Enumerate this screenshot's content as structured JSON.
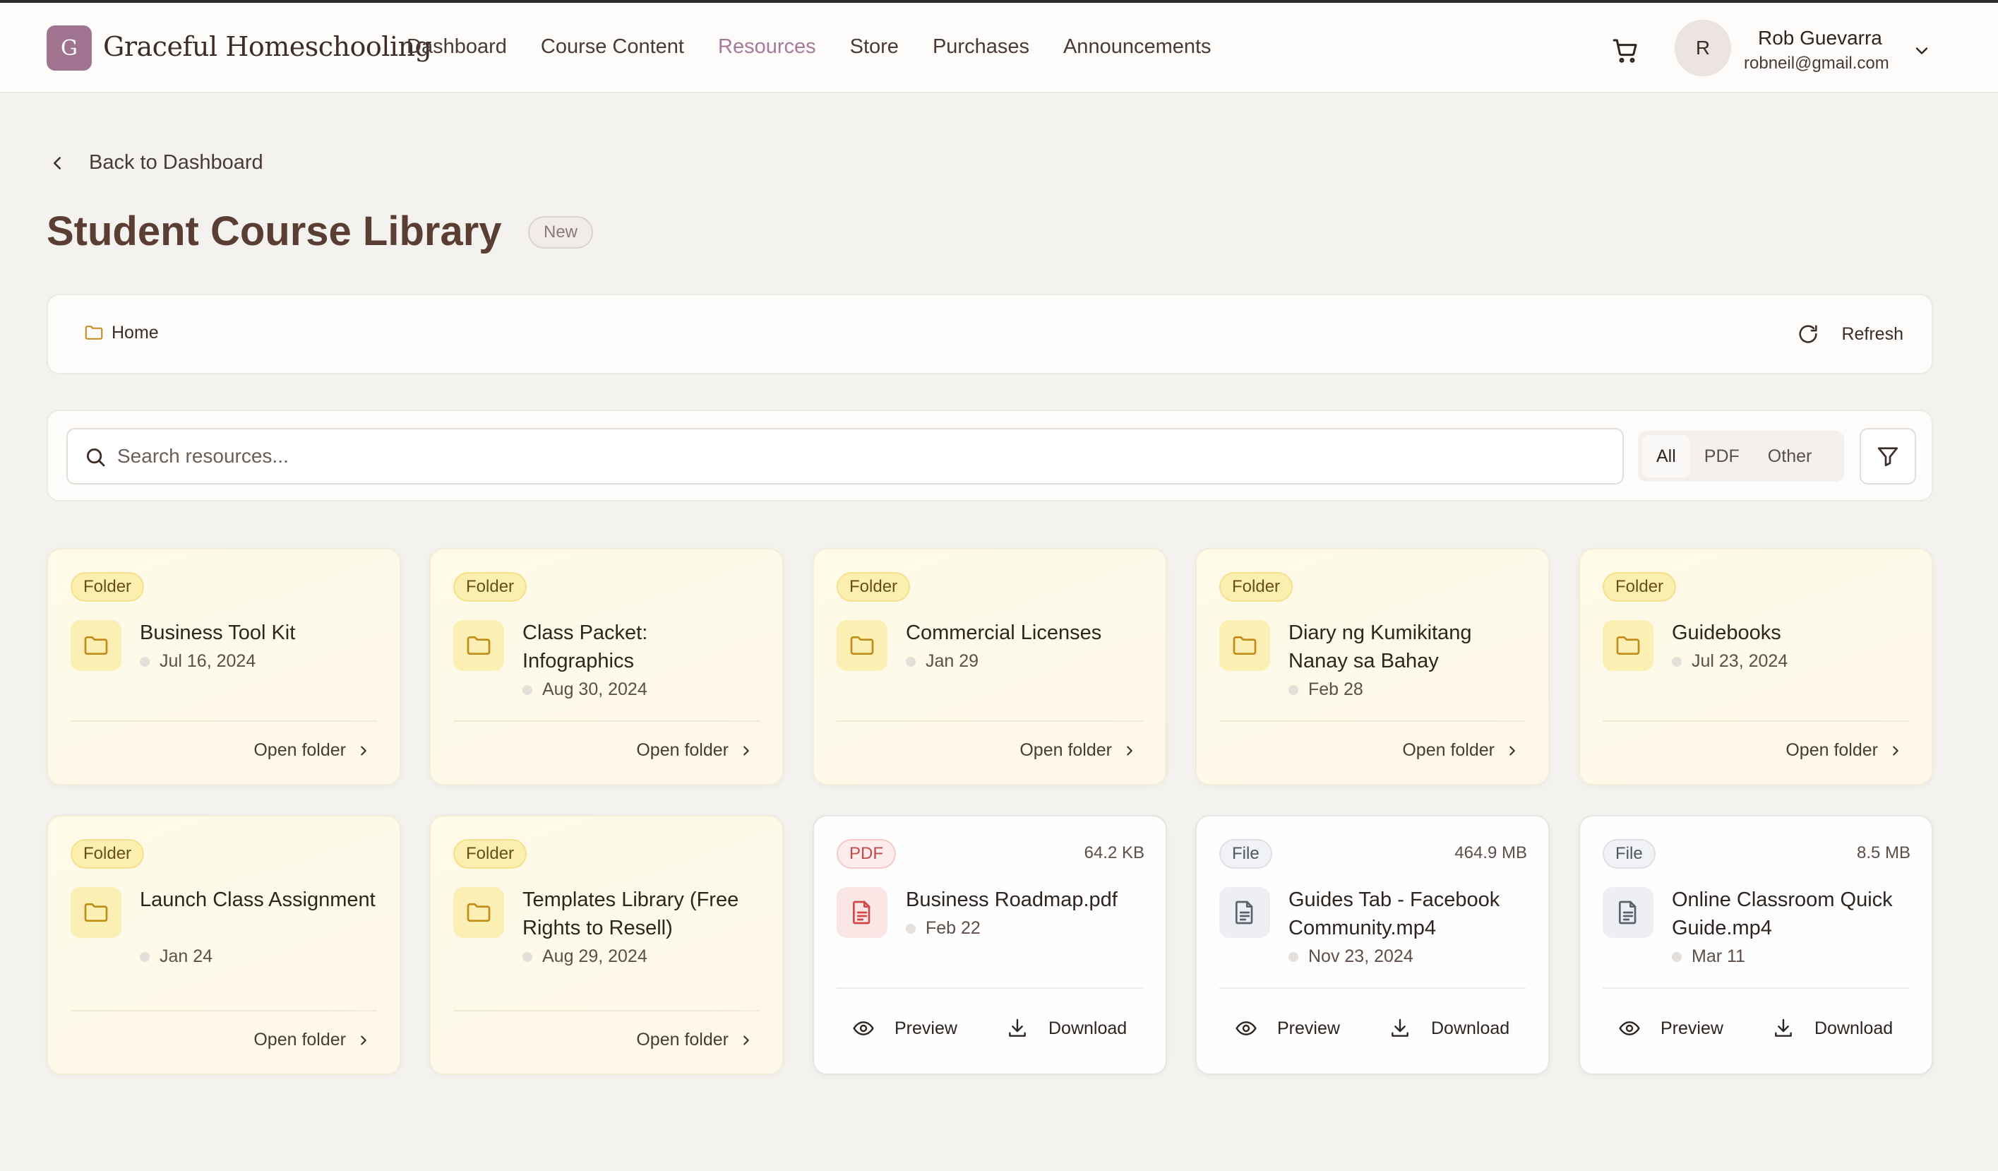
{
  "header": {
    "logo_letter": "G",
    "brand": "Graceful Homeschooling",
    "nav": [
      "Dashboard",
      "Course Content",
      "Resources",
      "Store",
      "Purchases",
      "Announcements"
    ],
    "active_nav": "Resources",
    "user": {
      "initial": "R",
      "name": "Rob Guevarra",
      "email": "robneil@gmail.com"
    }
  },
  "page": {
    "back_label": "Back to Dashboard",
    "title": "Student Course Library",
    "title_badge": "New"
  },
  "breadcrumb": {
    "home": "Home",
    "refresh_label": "Refresh"
  },
  "search": {
    "placeholder": "Search resources...",
    "filters": [
      "All",
      "PDF",
      "Other"
    ],
    "active_filter": "All"
  },
  "items": [
    {
      "kind": "folder",
      "badge": "Folder",
      "name": "Business Tool Kit",
      "date": "Jul 16, 2024",
      "action": "Open folder"
    },
    {
      "kind": "folder",
      "badge": "Folder",
      "name": "Class Packet: Infographics",
      "date": "Aug 30, 2024",
      "action": "Open folder"
    },
    {
      "kind": "folder",
      "badge": "Folder",
      "name": "Commercial Licenses",
      "date": "Jan 29",
      "action": "Open folder"
    },
    {
      "kind": "folder",
      "badge": "Folder",
      "name": "Diary ng Kumikitang Nanay sa Bahay",
      "date": "Feb 28",
      "action": "Open folder"
    },
    {
      "kind": "folder",
      "badge": "Folder",
      "name": "Guidebooks",
      "date": "Jul 23, 2024",
      "action": "Open folder"
    },
    {
      "kind": "folder",
      "badge": "Folder",
      "name": "Launch Class Assignment",
      "date": "Jan 24",
      "action": "Open folder"
    },
    {
      "kind": "folder",
      "badge": "Folder",
      "name": "Templates Library (Free Rights to Resell)",
      "date": "Aug 29, 2024",
      "action": "Open folder"
    },
    {
      "kind": "pdf",
      "badge": "PDF",
      "size": "64.2 KB",
      "name": "Business Roadmap.pdf",
      "date": "Feb 22",
      "preview": "Preview",
      "download": "Download"
    },
    {
      "kind": "file",
      "badge": "File",
      "size": "464.9 MB",
      "name": "Guides Tab - Facebook Community.mp4",
      "date": "Nov 23, 2024",
      "preview": "Preview",
      "download": "Download"
    },
    {
      "kind": "file",
      "badge": "File",
      "size": "8.5 MB",
      "name": "Online Classroom Quick Guide.mp4",
      "date": "Mar 11",
      "preview": "Preview",
      "download": "Download"
    }
  ],
  "colors": {
    "accent": "#a6799a",
    "folder_bg": "#fcefb4",
    "pdf_red": "#c24a4a"
  }
}
